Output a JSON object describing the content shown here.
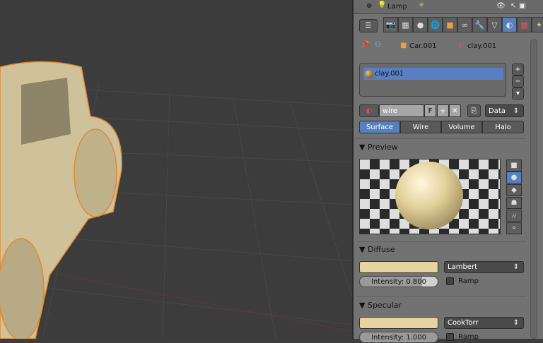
{
  "header": {
    "object_name": "Lamp"
  },
  "context_tabs": [
    "render",
    "render-layers",
    "scene",
    "world",
    "object",
    "constraints",
    "modifiers",
    "data",
    "material",
    "texture",
    "particles"
  ],
  "breadcrumb": {
    "object": "Car.001",
    "material": "clay.001"
  },
  "material_slots": [
    {
      "name": "clay.001"
    }
  ],
  "datablock": {
    "name_value": "wire",
    "fake_user": "F",
    "link": "Data"
  },
  "type_tabs": [
    {
      "label": "Surface",
      "active": true
    },
    {
      "label": "Wire"
    },
    {
      "label": "Volume"
    },
    {
      "label": "Halo"
    }
  ],
  "preview": {
    "title": "Preview"
  },
  "diffuse": {
    "title": "Diffuse",
    "color": "#e5d3a0",
    "shader": "Lambert",
    "intensity_label": "Intensity: 0.800",
    "intensity": 0.8,
    "ramp_label": "Ramp"
  },
  "specular": {
    "title": "Specular",
    "color": "#e5d3a0",
    "shader": "CookTorr",
    "intensity_label": "Intensity: 1.000",
    "intensity": 1.0,
    "ramp_label": "Ramp"
  }
}
